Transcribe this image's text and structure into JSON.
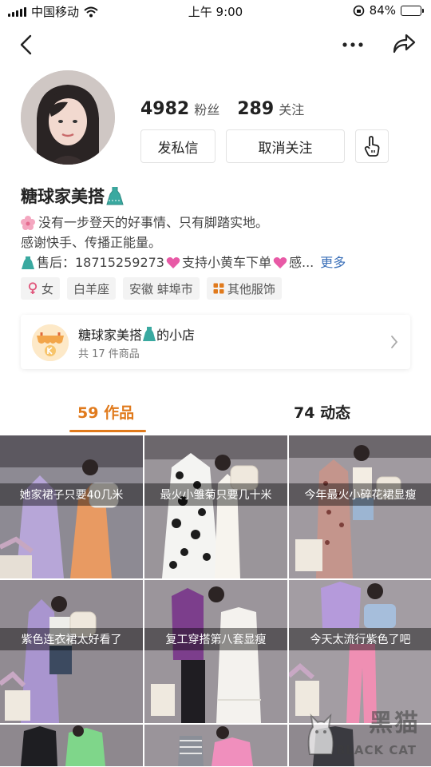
{
  "status_bar": {
    "carrier": "中国移动",
    "time": "上午 9:00",
    "battery_percent": "84%",
    "battery_level": 0.84
  },
  "profile": {
    "followers_count": "4982",
    "followers_label": "粉丝",
    "following_count": "289",
    "following_label": "关注",
    "message_button": "发私信",
    "unfollow_button": "取消关注",
    "nickname": "糖球家美搭",
    "bio_line1": "没有一步登天的好事情、只有脚踏实地。",
    "bio_line2": "感谢快手、传播正能量。",
    "bio_line3_a": "售后：18715259273",
    "bio_line3_b": "支持小黄车下单",
    "bio_line3_c": "感...",
    "bio_more": "更多",
    "tags": [
      {
        "label": "女",
        "icon": "female-icon"
      },
      {
        "label": "白羊座",
        "icon": ""
      },
      {
        "label": "安徽 蚌埠市",
        "icon": ""
      },
      {
        "label": "其他服饰",
        "icon": "category-icon"
      }
    ]
  },
  "shop": {
    "title_a": "糖球家美搭",
    "title_b": "的小店",
    "subtitle": "共 17 件商品"
  },
  "tabs": {
    "works_count": "59",
    "works_label": "作品",
    "moments_count": "74",
    "moments_label": "动态"
  },
  "grid": [
    {
      "caption": "她家裙子只要40几米"
    },
    {
      "caption": "最火小雏菊只要几十米"
    },
    {
      "caption": "今年最火小碎花裙显瘦"
    },
    {
      "caption": "紫色连衣裙太好看了"
    },
    {
      "caption": "复工穿搭第八套显瘦"
    },
    {
      "caption": "今天太流行紫色了吧"
    }
  ],
  "watermark": {
    "zh": "黑猫",
    "en": "BLACK CAT"
  },
  "colors": {
    "accent": "#e07a1c",
    "link": "#3a6fb8",
    "battery": "#3bc15a"
  }
}
